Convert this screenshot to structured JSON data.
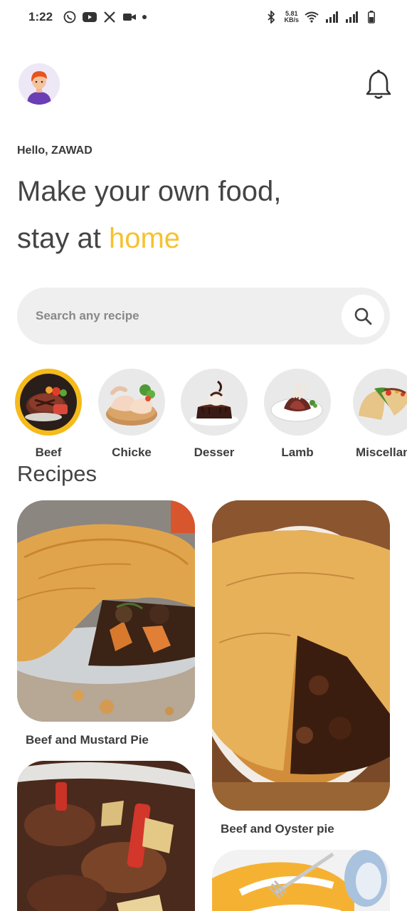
{
  "status_bar": {
    "time": "1:22",
    "net_speed_value": "5.81",
    "net_speed_unit": "KB/s",
    "left_icons": [
      "whatsapp-icon",
      "youtube-icon",
      "x-icon",
      "video-icon",
      "dot-icon"
    ],
    "right_icons": [
      "bluetooth-icon",
      "wifi-icon",
      "signal-icon",
      "signal-icon",
      "battery-icon"
    ]
  },
  "header": {
    "greeting": "Hello, ZAWAD",
    "headline_line1": "Make your own food,",
    "headline_line2_prefix": "stay at ",
    "headline_line2_accent": "home",
    "accent_color": "#f5c230"
  },
  "search": {
    "placeholder": "Search any recipe",
    "value": ""
  },
  "categories": [
    {
      "label": "Beef",
      "active": true
    },
    {
      "label": "Chicke",
      "active": false
    },
    {
      "label": "Desser",
      "active": false
    },
    {
      "label": "Lamb",
      "active": false
    },
    {
      "label": "Miscellane",
      "active": false
    }
  ],
  "recipes_title": "Recipes",
  "recipes": [
    {
      "title": "Beef and Mustard Pie"
    },
    {
      "title": "Beef and Oyster pie"
    },
    {
      "title": ""
    },
    {
      "title": ""
    }
  ]
}
